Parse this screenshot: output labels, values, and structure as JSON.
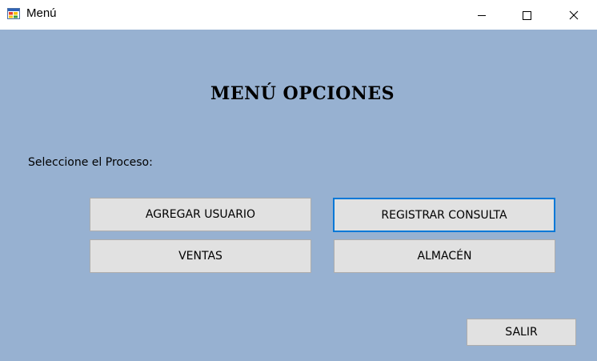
{
  "window": {
    "title": "Menú",
    "icon": "app-form-icon"
  },
  "controls": {
    "minimize": "minimize-icon",
    "maximize": "maximize-icon",
    "close": "close-icon"
  },
  "form": {
    "heading": "MENÚ OPCIONES",
    "prompt": "Seleccione el Proceso:",
    "buttons": {
      "agregar_usuario": "AGREGAR USUARIO",
      "registrar_consulta": "REGISTRAR CONSULTA",
      "ventas": "VENTAS",
      "almacen": "ALMACÉN",
      "salir": "SALIR"
    },
    "focused_button": "REGISTRAR CONSULTA"
  },
  "colors": {
    "client_background": "#97b1d1",
    "button_face": "#e1e1e1",
    "focus_border": "#0078d7"
  }
}
